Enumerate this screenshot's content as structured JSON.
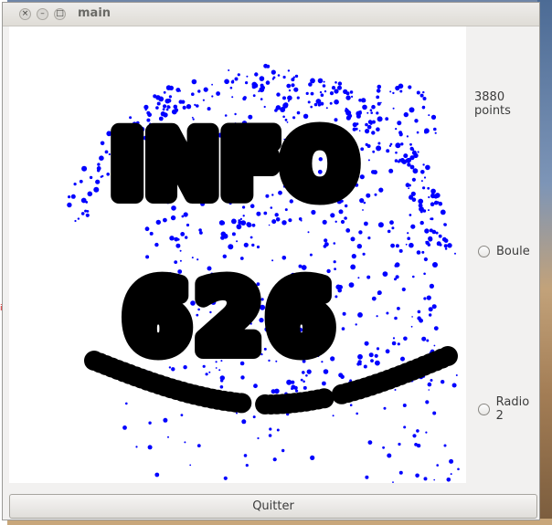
{
  "window": {
    "title": "main"
  },
  "canvas": {
    "text_rows": [
      "INFO",
      "626"
    ],
    "stroke_color": "#000000",
    "point_color": "#0000ff"
  },
  "status": {
    "count_label": "3880 points"
  },
  "options": [
    {
      "label": "Boule",
      "selected": false
    },
    {
      "label": "Radio 2",
      "selected": false
    }
  ],
  "buttons": {
    "quit_label": "Quitter"
  },
  "desktop": {
    "side_mark": "i."
  }
}
